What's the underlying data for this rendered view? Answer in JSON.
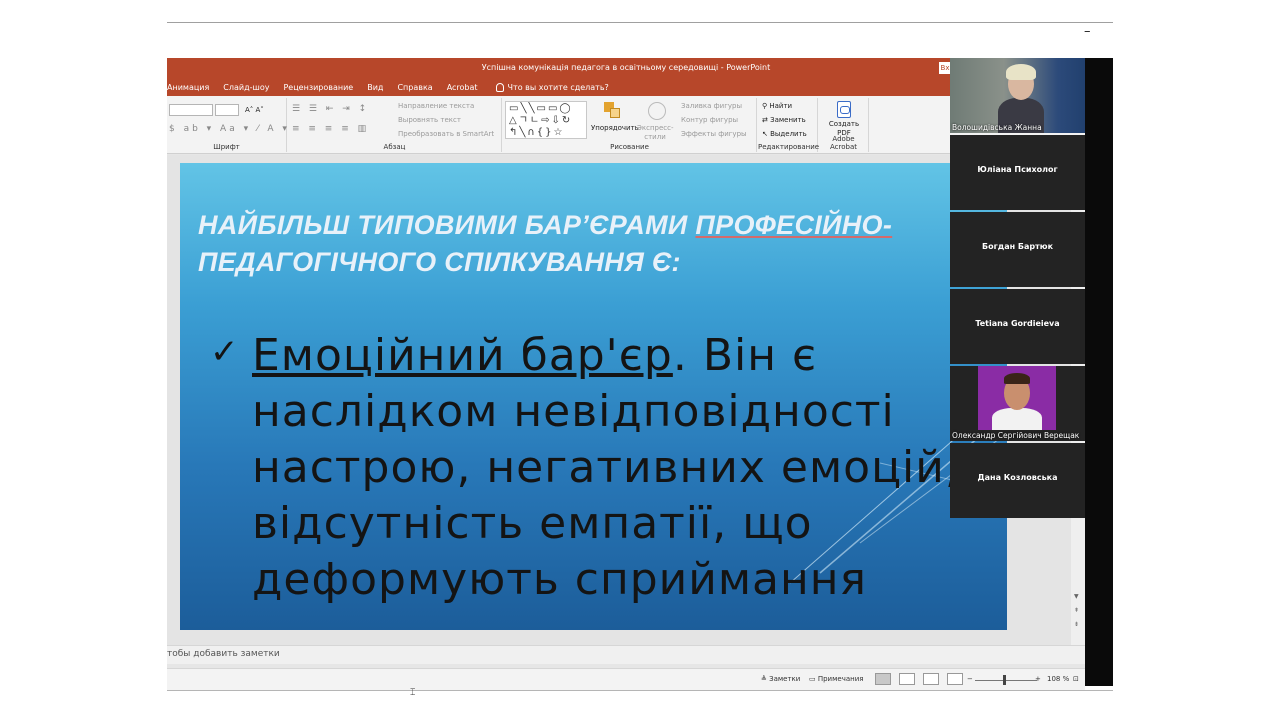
{
  "window": {
    "title": "Успішна комунікація педагога в освітньому середовищі  -  PowerPoint",
    "title_button": "Вх"
  },
  "ribbon_tabs": [
    "Анимация",
    "Слайд-шоу",
    "Рецензирование",
    "Вид",
    "Справка",
    "Acrobat"
  ],
  "tell_me": "Что вы хотите сделать?",
  "ribbon": {
    "font_size_controls": "A˄ A˅",
    "text_direction": "Направление текста",
    "align_text": "Выровнять текст",
    "smartart": "Преобразовать в SmartArt",
    "arrange": "Упорядочить",
    "express_styles": "Экспресс-стили",
    "fill": "Заливка фигуры",
    "outline": "Контур фигуры",
    "effects": "Эффекты фигуры",
    "find": "Найти",
    "replace": "Заменить",
    "select": "Выделить",
    "create_pdf": "Создать PDF",
    "groups": {
      "font": "Шрифт",
      "paragraph": "Абзац",
      "drawing": "Рисование",
      "editing": "Редактирование",
      "acrobat": "Adobe Acrobat"
    }
  },
  "slide": {
    "title_part1": "НАЙБІЛЬШ ТИПОВИМИ БАР’ЄРАМИ ",
    "title_underlined": "ПРОФЕСІЙНО-",
    "title_line2": "ПЕДАГОГІЧНОГО СПІЛКУВАННЯ Є:",
    "bullet_mark": "✓",
    "bullet_underlined": "Емоційний бар'єр",
    "bullet_rest": ". Він є наслідком невідповідності настрою, негативних емоцій, відсутність емпатії, що деформують сприймання"
  },
  "notes_placeholder": "тобы добавить заметки",
  "status": {
    "notes": "Заметки",
    "comments": "Примечания",
    "zoom": "108 %"
  },
  "participants": [
    {
      "name": "Волошидівська Жанна",
      "video": true
    },
    {
      "name": "Юліана Психолог",
      "video": false
    },
    {
      "name": "Богдан Бартюк",
      "video": false
    },
    {
      "name": "Tetiana Gordieieva",
      "video": false
    },
    {
      "name": "Олександр Сергійович Верещак",
      "video": true
    },
    {
      "name": "Дана Козловська",
      "video": false
    }
  ],
  "colors": {
    "powerpoint_accent": "#b7472a",
    "slide_top": "#62c4e6",
    "slide_bottom": "#1c5d9a"
  }
}
